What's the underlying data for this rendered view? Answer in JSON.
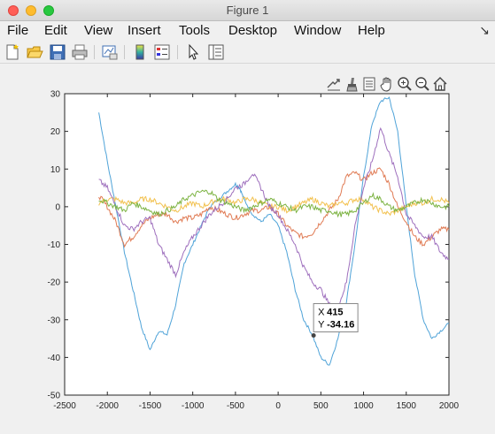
{
  "window": {
    "title": "Figure 1"
  },
  "menu": {
    "items": [
      "File",
      "Edit",
      "View",
      "Insert",
      "Tools",
      "Desktop",
      "Window",
      "Help"
    ]
  },
  "toolbar": {
    "buttons": [
      "new-figure-icon",
      "open-file-icon",
      "save-icon",
      "print-icon",
      "link-plot-icon",
      "insert-colorbar-icon",
      "insert-legend-icon",
      "edit-plot-pointer-icon",
      "property-inspector-icon"
    ]
  },
  "axes_toolbar": {
    "buttons": [
      "export-icon",
      "brush-icon",
      "datatip-icon",
      "pan-hand-icon",
      "zoom-in-icon",
      "zoom-out-icon",
      "home-icon"
    ]
  },
  "datatip": {
    "x_label": "X",
    "x_value": "415",
    "y_label": "Y",
    "y_value": "-34.16"
  },
  "chart_data": {
    "type": "line",
    "xlim": [
      -2500,
      2000
    ],
    "ylim": [
      -50,
      30
    ],
    "xticks": [
      -2500,
      -2000,
      -1500,
      -1000,
      -500,
      0,
      500,
      1000,
      1500,
      2000
    ],
    "yticks": [
      -50,
      -40,
      -30,
      -20,
      -10,
      0,
      10,
      20,
      30
    ],
    "grid": false,
    "colors": {
      "blue": "#5b9bd5",
      "orange": "#e07b54",
      "yellow": "#f2c14e",
      "purple": "#9e6fbd",
      "green": "#7cb342"
    },
    "series": [
      {
        "color": "#4fa3d8",
        "points": [
          [
            -2100,
            25
          ],
          [
            -2000,
            12
          ],
          [
            -1900,
            0
          ],
          [
            -1800,
            -12
          ],
          [
            -1700,
            -22
          ],
          [
            -1600,
            -32
          ],
          [
            -1500,
            -38
          ],
          [
            -1400,
            -33
          ],
          [
            -1300,
            -34
          ],
          [
            -1200,
            -26
          ],
          [
            -1100,
            -15
          ],
          [
            -1000,
            -10
          ],
          [
            -900,
            -5
          ],
          [
            -800,
            0
          ],
          [
            -700,
            2
          ],
          [
            -600,
            4
          ],
          [
            -500,
            6
          ],
          [
            -450,
            5
          ],
          [
            -400,
            2
          ],
          [
            -300,
            -2
          ],
          [
            -200,
            -4
          ],
          [
            -100,
            -2
          ],
          [
            0,
            -5
          ],
          [
            100,
            -12
          ],
          [
            200,
            -22
          ],
          [
            300,
            -30
          ],
          [
            400,
            -34
          ],
          [
            500,
            -40
          ],
          [
            600,
            -42
          ],
          [
            700,
            -35
          ],
          [
            800,
            -25
          ],
          [
            900,
            -10
          ],
          [
            1000,
            8
          ],
          [
            1100,
            22
          ],
          [
            1200,
            28
          ],
          [
            1300,
            29
          ],
          [
            1400,
            20
          ],
          [
            1500,
            0
          ],
          [
            1600,
            -18
          ],
          [
            1700,
            -30
          ],
          [
            1800,
            -35
          ],
          [
            1900,
            -33
          ],
          [
            2000,
            -31
          ]
        ]
      },
      {
        "color": "#e07b54",
        "points": [
          [
            -2100,
            3
          ],
          [
            -2000,
            0
          ],
          [
            -1900,
            -4
          ],
          [
            -1800,
            -10
          ],
          [
            -1700,
            -8
          ],
          [
            -1600,
            -5
          ],
          [
            -1500,
            -3
          ],
          [
            -1400,
            -2
          ],
          [
            -1300,
            -2
          ],
          [
            -1200,
            -4
          ],
          [
            -1100,
            -3
          ],
          [
            -1000,
            -3
          ],
          [
            -900,
            -2
          ],
          [
            -800,
            0
          ],
          [
            -700,
            -1
          ],
          [
            -600,
            -2
          ],
          [
            -500,
            -3
          ],
          [
            -400,
            -2
          ],
          [
            -300,
            -1
          ],
          [
            -200,
            -1
          ],
          [
            -100,
            0
          ],
          [
            0,
            -2
          ],
          [
            100,
            -5
          ],
          [
            200,
            -7
          ],
          [
            300,
            -8
          ],
          [
            400,
            -7
          ],
          [
            500,
            -4
          ],
          [
            600,
            -1
          ],
          [
            700,
            2
          ],
          [
            800,
            8
          ],
          [
            900,
            9
          ],
          [
            1000,
            7
          ],
          [
            1100,
            9
          ],
          [
            1200,
            10
          ],
          [
            1300,
            6
          ],
          [
            1400,
            0
          ],
          [
            1500,
            -4
          ],
          [
            1600,
            -8
          ],
          [
            1700,
            -10
          ],
          [
            1800,
            -8
          ],
          [
            1900,
            -6
          ],
          [
            2000,
            -6
          ]
        ]
      },
      {
        "color": "#f2c14e",
        "points": [
          [
            -2100,
            1
          ],
          [
            -2000,
            2
          ],
          [
            -1900,
            2
          ],
          [
            -1800,
            1
          ],
          [
            -1700,
            1
          ],
          [
            -1600,
            2
          ],
          [
            -1500,
            2
          ],
          [
            -1400,
            1
          ],
          [
            -1300,
            0
          ],
          [
            -1200,
            -1
          ],
          [
            -1100,
            0
          ],
          [
            -1000,
            1
          ],
          [
            -900,
            0
          ],
          [
            -800,
            1
          ],
          [
            -700,
            2
          ],
          [
            -600,
            2
          ],
          [
            -500,
            1
          ],
          [
            -400,
            2
          ],
          [
            -300,
            2
          ],
          [
            -200,
            1
          ],
          [
            -100,
            0
          ],
          [
            0,
            0
          ],
          [
            100,
            -1
          ],
          [
            200,
            0
          ],
          [
            300,
            1
          ],
          [
            400,
            2
          ],
          [
            500,
            1
          ],
          [
            600,
            0
          ],
          [
            700,
            1
          ],
          [
            800,
            1
          ],
          [
            900,
            2
          ],
          [
            1000,
            2
          ],
          [
            1100,
            0
          ],
          [
            1200,
            -1
          ],
          [
            1300,
            -2
          ],
          [
            1400,
            -1
          ],
          [
            1500,
            0
          ],
          [
            1600,
            1
          ],
          [
            1700,
            1
          ],
          [
            1800,
            2
          ],
          [
            1900,
            2
          ],
          [
            2000,
            1
          ]
        ]
      },
      {
        "color": "#9e6fbd",
        "points": [
          [
            -2100,
            7
          ],
          [
            -2000,
            5
          ],
          [
            -1900,
            0
          ],
          [
            -1800,
            -5
          ],
          [
            -1700,
            -6
          ],
          [
            -1600,
            -4
          ],
          [
            -1500,
            -3
          ],
          [
            -1400,
            -10
          ],
          [
            -1300,
            -14
          ],
          [
            -1200,
            -18
          ],
          [
            -1100,
            -12
          ],
          [
            -1000,
            -8
          ],
          [
            -900,
            -5
          ],
          [
            -800,
            -2
          ],
          [
            -700,
            0
          ],
          [
            -600,
            2
          ],
          [
            -500,
            5
          ],
          [
            -400,
            6
          ],
          [
            -300,
            9
          ],
          [
            -200,
            5
          ],
          [
            -100,
            0
          ],
          [
            0,
            -2
          ],
          [
            100,
            -6
          ],
          [
            200,
            -10
          ],
          [
            300,
            -16
          ],
          [
            400,
            -20
          ],
          [
            500,
            -22
          ],
          [
            600,
            -26
          ],
          [
            700,
            -27
          ],
          [
            800,
            -20
          ],
          [
            900,
            -5
          ],
          [
            1000,
            5
          ],
          [
            1100,
            12
          ],
          [
            1200,
            21
          ],
          [
            1300,
            14
          ],
          [
            1400,
            8
          ],
          [
            1500,
            -2
          ],
          [
            1600,
            -5
          ],
          [
            1700,
            -8
          ],
          [
            1800,
            -8
          ],
          [
            1900,
            -12
          ],
          [
            2000,
            -14
          ]
        ]
      },
      {
        "color": "#7cb342",
        "points": [
          [
            -2100,
            2
          ],
          [
            -2000,
            1
          ],
          [
            -1900,
            0
          ],
          [
            -1800,
            -1
          ],
          [
            -1700,
            1
          ],
          [
            -1600,
            0
          ],
          [
            -1500,
            -1
          ],
          [
            -1400,
            -2
          ],
          [
            -1300,
            -1
          ],
          [
            -1200,
            0
          ],
          [
            -1100,
            2
          ],
          [
            -1000,
            3
          ],
          [
            -900,
            4
          ],
          [
            -800,
            4
          ],
          [
            -700,
            2
          ],
          [
            -600,
            1
          ],
          [
            -500,
            0
          ],
          [
            -400,
            -1
          ],
          [
            -300,
            0
          ],
          [
            -200,
            1
          ],
          [
            -100,
            2
          ],
          [
            0,
            1
          ],
          [
            100,
            0
          ],
          [
            200,
            -1
          ],
          [
            300,
            0
          ],
          [
            400,
            0
          ],
          [
            500,
            -1
          ],
          [
            600,
            -1
          ],
          [
            700,
            -2
          ],
          [
            800,
            -2
          ],
          [
            900,
            -1
          ],
          [
            1000,
            1
          ],
          [
            1100,
            3
          ],
          [
            1200,
            2
          ],
          [
            1300,
            0
          ],
          [
            1400,
            -1
          ],
          [
            1500,
            0
          ],
          [
            1600,
            1
          ],
          [
            1700,
            2
          ],
          [
            1800,
            1
          ],
          [
            1900,
            0
          ],
          [
            2000,
            0
          ]
        ]
      }
    ],
    "datatip_point": {
      "x": 415,
      "y": -34.16
    }
  }
}
